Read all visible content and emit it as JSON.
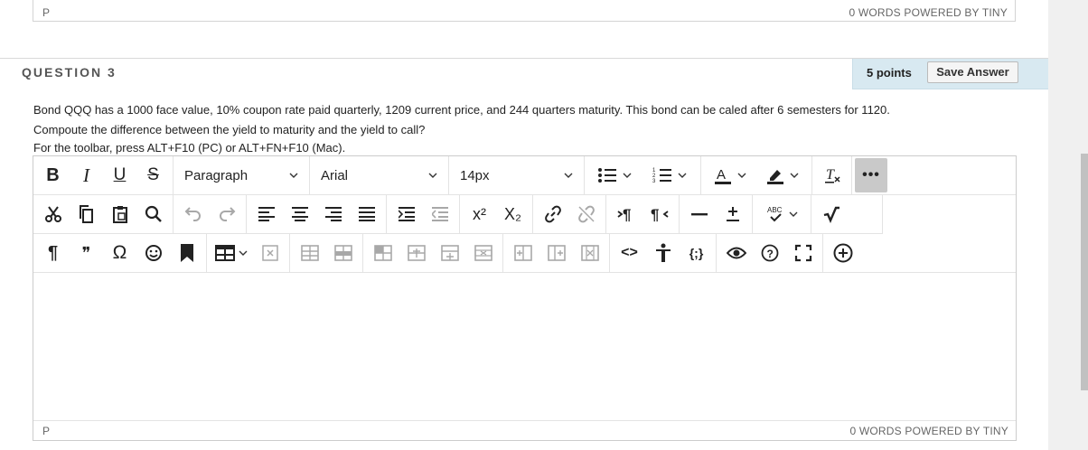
{
  "prev_editor": {
    "path": "P",
    "status": "0 WORDS  POWERED BY TINY"
  },
  "question": {
    "title": "QUESTION 3",
    "points": "5 points",
    "save_label": "Save Answer",
    "text_line1": "Bond QQQ has a 1000 face value, 10% coupon rate paid quarterly, 1209 current price, and 244 quarters maturity. This bond can be caled after 6 semesters for 1120.",
    "text_line2": "Compoute the difference between the yield to maturity and the yield to call?",
    "hint": "For the toolbar, press ALT+F10 (PC) or ALT+FN+F10 (Mac)."
  },
  "toolbar": {
    "bold": "B",
    "italic": "I",
    "underline": "U",
    "strike": "S",
    "block_format": "Paragraph",
    "font_family": "Arial",
    "font_size": "14px",
    "more": "•••",
    "superscript": "x²",
    "subscript": "X₂",
    "paragraph_mark": "¶",
    "quote": "❞",
    "omega": "Ω",
    "code": "<>",
    "braces": "{;}"
  },
  "editor": {
    "content": "",
    "path": "P",
    "status": "0 WORDS  POWERED BY TINY"
  },
  "icons": [
    "cut-icon",
    "copy-icon",
    "paste-icon",
    "find-icon",
    "undo-icon",
    "redo-icon",
    "align-left-icon",
    "align-center-icon",
    "align-right-icon",
    "justify-icon",
    "indent-icon",
    "outdent-icon",
    "link-icon",
    "unlink-icon",
    "ltr-icon",
    "rtl-icon",
    "horizontal-rule-icon",
    "plus-minus-icon",
    "spellcheck-icon",
    "math-icon",
    "bookmark-icon",
    "table-icon",
    "emoticon-icon",
    "accessibility-icon",
    "preview-icon",
    "help-icon",
    "fullscreen-icon",
    "add-content-icon"
  ]
}
